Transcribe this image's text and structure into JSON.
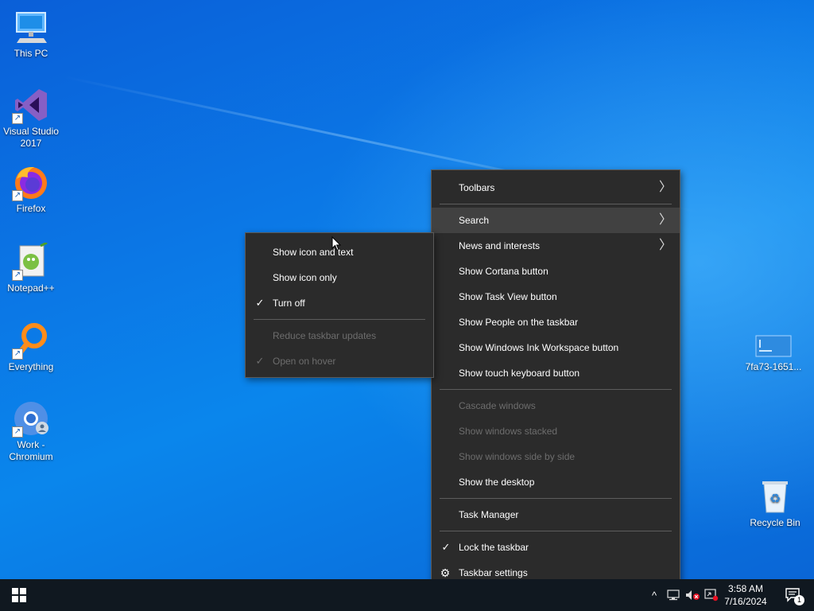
{
  "desktop": {
    "icons": [
      {
        "label_line1": "This PC",
        "label_line2": ""
      },
      {
        "label_line1": "Visual Studio",
        "label_line2": "2017"
      },
      {
        "label_line1": "Firefox",
        "label_line2": ""
      },
      {
        "label_line1": "Notepad++",
        "label_line2": ""
      },
      {
        "label_line1": "Everything",
        "label_line2": ""
      },
      {
        "label_line1": "Work -",
        "label_line2": "Chromium"
      },
      {
        "label_line1": "7fa73-1651...",
        "label_line2": ""
      },
      {
        "label_line1": "Recycle Bin",
        "label_line2": ""
      }
    ]
  },
  "context_menu": {
    "items": {
      "toolbars": "Toolbars",
      "search": "Search",
      "news": "News and interests",
      "cortana": "Show Cortana button",
      "taskview": "Show Task View button",
      "people": "Show People on the taskbar",
      "ink": "Show Windows Ink Workspace button",
      "touch_keyboard": "Show touch keyboard button",
      "cascade": "Cascade windows",
      "stacked": "Show windows stacked",
      "side_by_side": "Show windows side by side",
      "show_desktop": "Show the desktop",
      "task_manager": "Task Manager",
      "lock": "Lock the taskbar",
      "settings": "Taskbar settings"
    },
    "arrow_glyph": "〉",
    "check_glyph": "✓",
    "gear_glyph": "⚙"
  },
  "submenu": {
    "items": {
      "icon_and_text": "Show icon and text",
      "icon_only": "Show icon only",
      "turn_off": "Turn off",
      "reduce_updates": "Reduce taskbar updates",
      "open_on_hover": "Open on hover"
    }
  },
  "taskbar": {
    "clock_time": "3:58 AM",
    "clock_date": "7/16/2024",
    "notification_count": "1",
    "tray_chevron": "^"
  },
  "colors": {
    "menu_bg": "#2b2b2b",
    "menu_highlight": "#414141",
    "disabled_text": "#6d6d6d",
    "taskbar_bg": "#101820"
  }
}
